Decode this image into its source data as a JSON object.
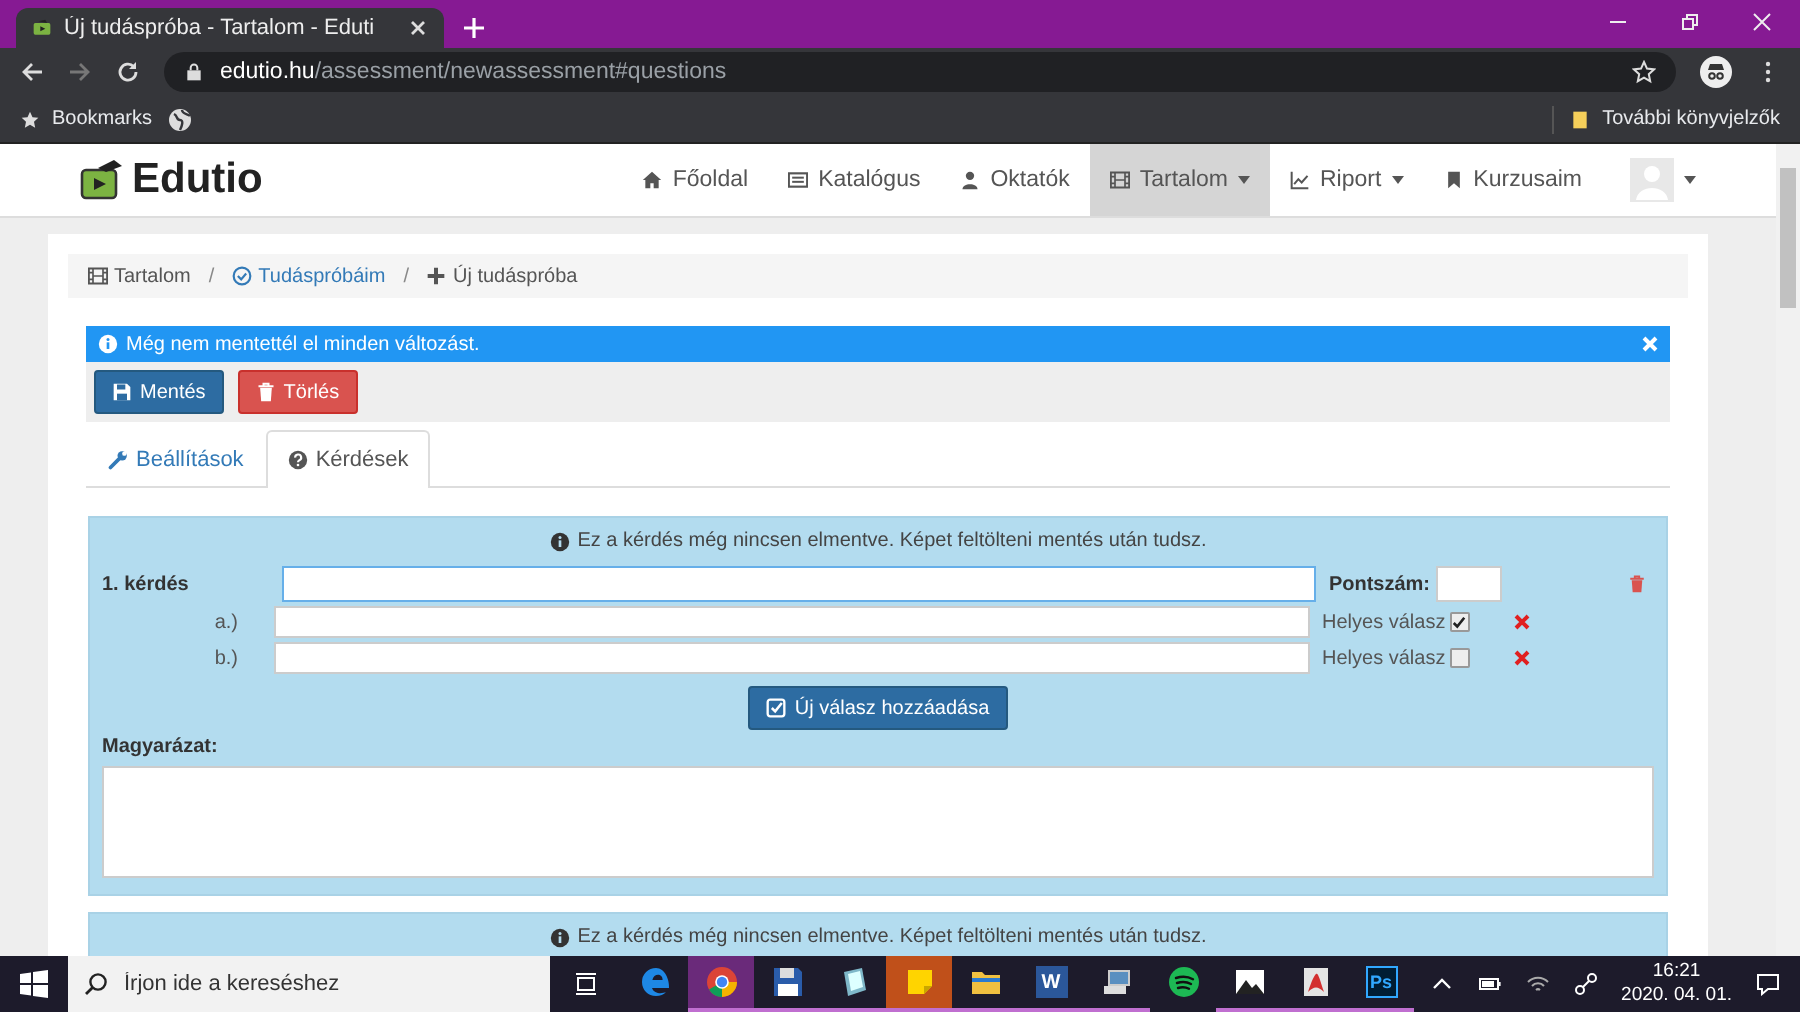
{
  "browser": {
    "tab_title": "Új tudáspróba - Tartalom - Eduti",
    "url_host": "edutio.hu",
    "url_path": "/assessment/newassessment#questions",
    "bookmarks_label": "Bookmarks",
    "other_bookmarks": "További könyvjelzők"
  },
  "nav": {
    "brand": "Edutio",
    "items": [
      {
        "label": "Főoldal",
        "kind": "home",
        "dropdown": false,
        "selected": false
      },
      {
        "label": "Katalógus",
        "kind": "list",
        "dropdown": false,
        "selected": false
      },
      {
        "label": "Oktatók",
        "kind": "user",
        "dropdown": false,
        "selected": false
      },
      {
        "label": "Tartalom",
        "kind": "film",
        "dropdown": true,
        "selected": true
      },
      {
        "label": "Riport",
        "kind": "chart",
        "dropdown": true,
        "selected": false
      },
      {
        "label": "Kurzusaim",
        "kind": "bookmark",
        "dropdown": false,
        "selected": false
      }
    ]
  },
  "breadcrumb": [
    {
      "label": "Tartalom",
      "kind": "film",
      "link": false
    },
    {
      "separator": "/",
      "label": "Tudáspróbáim",
      "kind": "check",
      "link": true
    },
    {
      "separator": "/",
      "label": "Új tudáspróba",
      "kind": "plus",
      "link": false
    }
  ],
  "alert": "Még nem mentettél el minden változást.",
  "actions": [
    {
      "label": "Mentés",
      "kind": "save"
    },
    {
      "label": "Törlés",
      "kind": "delete"
    }
  ],
  "tabs": [
    {
      "label": "Beállítások",
      "kind": "wrench",
      "selected": false
    },
    {
      "label": "Kérdések",
      "kind": "question",
      "selected": true
    }
  ],
  "questions": [
    {
      "notice": "Ez a kérdés még nincsen elmentve. Képet feltölteni mentés után tudsz.",
      "label": "1. kérdés",
      "points_label": "Pontszám:",
      "answers": [
        {
          "letter": "a.)",
          "correct_label": "Helyes válasz",
          "correct": true
        },
        {
          "letter": "b.)",
          "correct_label": "Helyes válasz",
          "correct": false
        }
      ],
      "add_button": "Új válasz hozzáadása",
      "explanation_label": "Magyarázat:"
    },
    {
      "notice": "Ez a kérdés még nincsen elmentve. Képet feltölteni mentés után tudsz."
    }
  ],
  "taskbar": {
    "search_placeholder": "Írjon ide a kereséshez",
    "apps": [
      {
        "kind": "edge",
        "running": false,
        "selected": false
      },
      {
        "kind": "chrome",
        "running": true,
        "selected": true
      },
      {
        "kind": "floppy",
        "running": true,
        "selected": false
      },
      {
        "kind": "notebook",
        "running": true,
        "selected": false
      },
      {
        "kind": "sticky",
        "running": true,
        "selected": false
      },
      {
        "kind": "folder",
        "running": true,
        "selected": false
      },
      {
        "kind": "word",
        "label": "W",
        "running": true,
        "selected": false
      },
      {
        "kind": "computer",
        "running": true,
        "selected": false
      },
      {
        "kind": "spotify",
        "running": false,
        "selected": false
      },
      {
        "kind": "photo",
        "running": true,
        "selected": false
      },
      {
        "kind": "red-app",
        "running": true,
        "selected": false
      },
      {
        "kind": "photoshop",
        "label": "Ps",
        "running": true,
        "selected": false
      }
    ],
    "time": "16:21",
    "date": "2020. 04. 01."
  }
}
